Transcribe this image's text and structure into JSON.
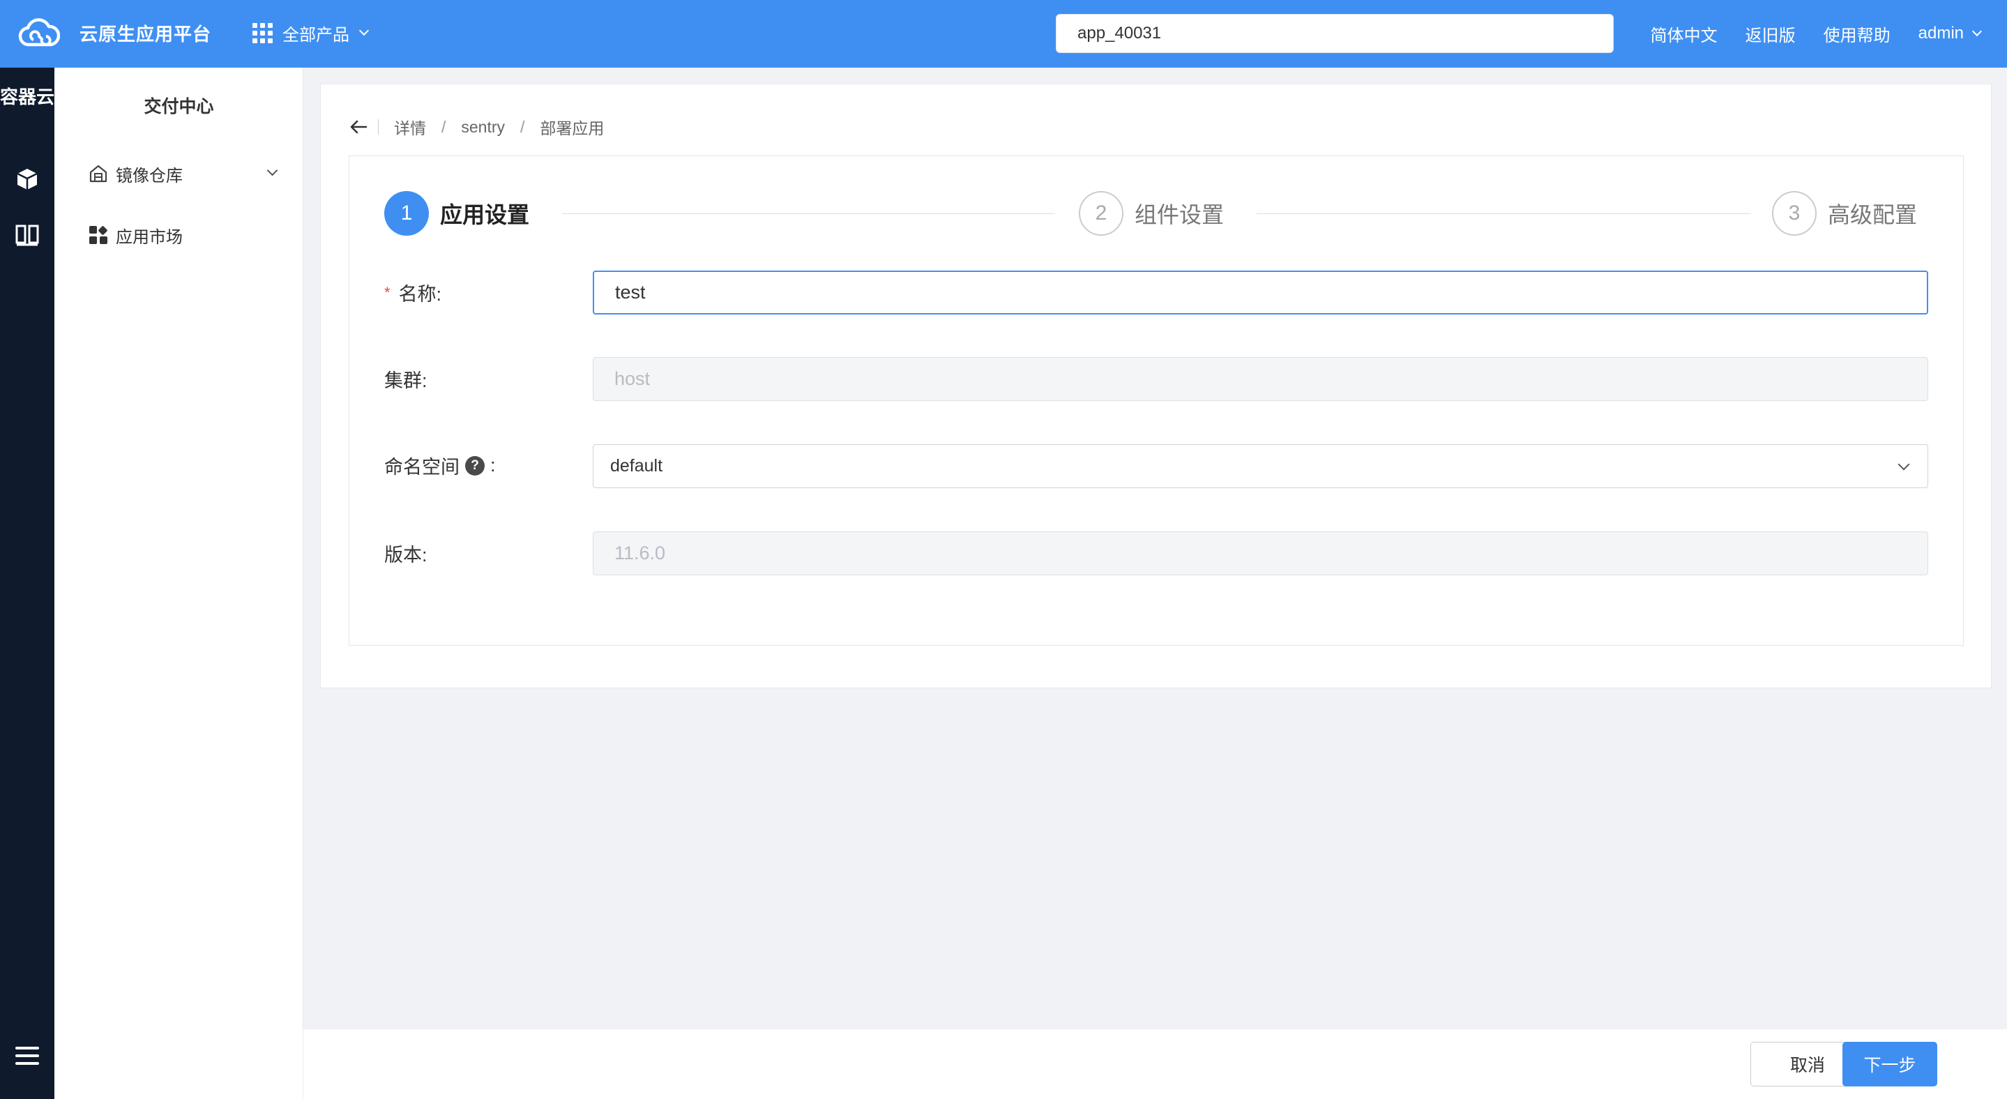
{
  "header": {
    "app_name": "云原生应用平台",
    "products_label": "全部产品",
    "search_value": "app_40031",
    "links": {
      "language": "简体中文",
      "old_version": "返旧版",
      "help": "使用帮助",
      "user": "admin"
    },
    "colors": {
      "bar": "#3f8ff3"
    }
  },
  "rail": {
    "title": "容器云",
    "icons": [
      "cube-icon",
      "columns-icon",
      "menu-icon"
    ]
  },
  "sidenav": {
    "title": "交付中心",
    "items": [
      {
        "label": "镜像仓库",
        "icon": "warehouse-icon",
        "expandable": true
      },
      {
        "label": "应用市场",
        "icon": "apps-grid-icon",
        "expandable": false
      }
    ]
  },
  "breadcrumb": {
    "items": [
      "详情",
      "sentry",
      "部署应用"
    ]
  },
  "steps": [
    {
      "number": "1",
      "label": "应用设置",
      "state": "active"
    },
    {
      "number": "2",
      "label": "组件设置",
      "state": "inactive"
    },
    {
      "number": "3",
      "label": "高级配置",
      "state": "inactive"
    }
  ],
  "form": {
    "name": {
      "label": "名称:",
      "required_mark": "*",
      "value": "test"
    },
    "cluster": {
      "label": "集群:",
      "value": "host"
    },
    "namespace": {
      "label": "命名空间",
      "suffix": ":",
      "help": "?",
      "value": "default"
    },
    "version": {
      "label": "版本:",
      "value": "11.6.0"
    }
  },
  "footer": {
    "cancel_label": "取消",
    "next_label": "下一步"
  }
}
